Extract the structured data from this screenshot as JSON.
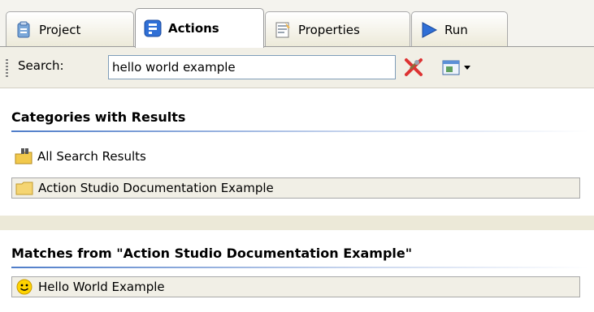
{
  "tabs": [
    {
      "label": "Project",
      "icon": "project-icon"
    },
    {
      "label": "Actions",
      "icon": "actions-icon"
    },
    {
      "label": "Properties",
      "icon": "properties-icon"
    },
    {
      "label": "Run",
      "icon": "run-icon"
    }
  ],
  "toolbar": {
    "search_label": "Search:",
    "search_value": "hello world example"
  },
  "categories": {
    "heading": "Categories with Results",
    "items": [
      {
        "label": "All Search Results",
        "icon": "search-results-folder-icon"
      },
      {
        "label": "Action Studio Documentation Example",
        "icon": "folder-icon"
      }
    ]
  },
  "matches": {
    "heading": "Matches from \"Action Studio Documentation Example\"",
    "items": [
      {
        "label": "Hello World Example",
        "icon": "smiley-icon"
      }
    ]
  },
  "colors": {
    "accent": "#4f7dc9",
    "tab_active_bg": "#ffffff",
    "chrome_bg": "#ece9d8"
  }
}
